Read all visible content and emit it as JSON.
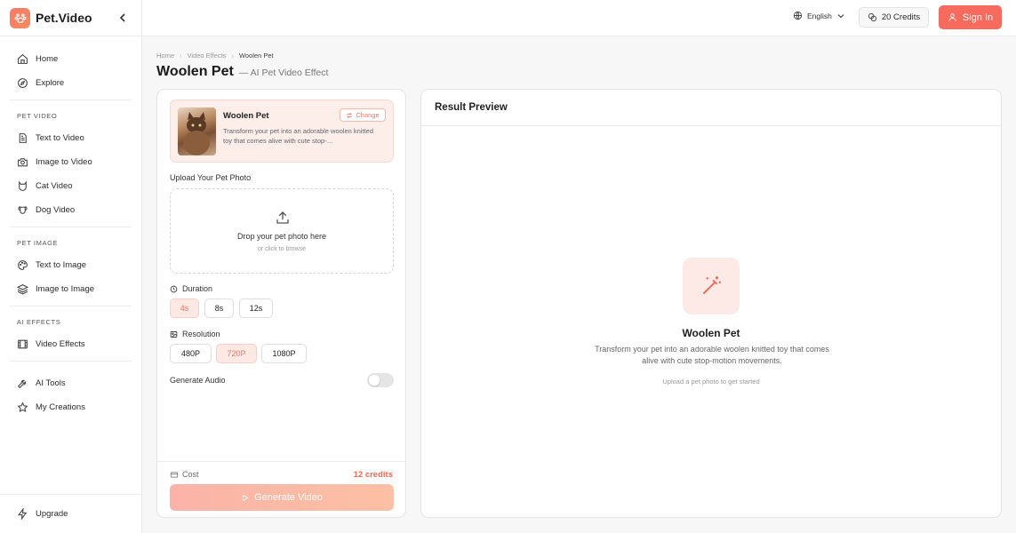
{
  "brand": {
    "name": "Pet.Video"
  },
  "sidebar": {
    "items_top": [
      {
        "label": "Home",
        "icon": "home-icon"
      },
      {
        "label": "Explore",
        "icon": "compass-icon"
      }
    ],
    "sections": [
      {
        "title": "PET VIDEO",
        "items": [
          {
            "label": "Text to Video",
            "icon": "document-icon"
          },
          {
            "label": "Image to Video",
            "icon": "camera-icon"
          },
          {
            "label": "Cat Video",
            "icon": "cat-icon"
          },
          {
            "label": "Dog Video",
            "icon": "dog-icon"
          }
        ]
      },
      {
        "title": "PET IMAGE",
        "items": [
          {
            "label": "Text to Image",
            "icon": "palette-icon"
          },
          {
            "label": "Image to Image",
            "icon": "layers-icon"
          }
        ]
      },
      {
        "title": "AI EFFECTS",
        "items": [
          {
            "label": "Video Effects",
            "icon": "film-icon"
          }
        ]
      }
    ],
    "items_more": [
      {
        "label": "AI Tools",
        "icon": "wrench-icon"
      },
      {
        "label": "My Creations",
        "icon": "star-icon"
      }
    ],
    "upgrade": "Upgrade"
  },
  "topbar": {
    "language": "English",
    "credits": "20 Credits",
    "sign_in": "Sign In"
  },
  "breadcrumb": [
    "Home",
    "Video Effects",
    "Woolen Pet"
  ],
  "page": {
    "title": "Woolen Pet",
    "subtitle": "— AI Pet Video Effect"
  },
  "effect": {
    "name": "Woolen Pet",
    "description": "Transform your pet into an adorable woolen knitted toy that comes alive with cute stop-…",
    "change": "Change"
  },
  "upload": {
    "label": "Upload Your Pet Photo",
    "drop_text": "Drop your pet photo here",
    "browse_text": "or click to browse"
  },
  "duration": {
    "label": "Duration",
    "options": [
      "4s",
      "8s",
      "12s"
    ],
    "selected": "4s"
  },
  "resolution": {
    "label": "Resolution",
    "options": [
      "480P",
      "720P",
      "1080P"
    ],
    "selected": "720P"
  },
  "audio": {
    "label": "Generate Audio",
    "enabled": false
  },
  "cost": {
    "label": "Cost",
    "value": "12 credits"
  },
  "generate_button": "Generate Video",
  "result": {
    "header": "Result Preview",
    "title": "Woolen Pet",
    "description": "Transform your pet into an adorable woolen knitted toy that comes alive with cute stop-motion movements.",
    "hint": "Upload a pet photo to get started"
  },
  "colors": {
    "accent": "#f76b5e",
    "accent_soft": "#fde8e4"
  }
}
